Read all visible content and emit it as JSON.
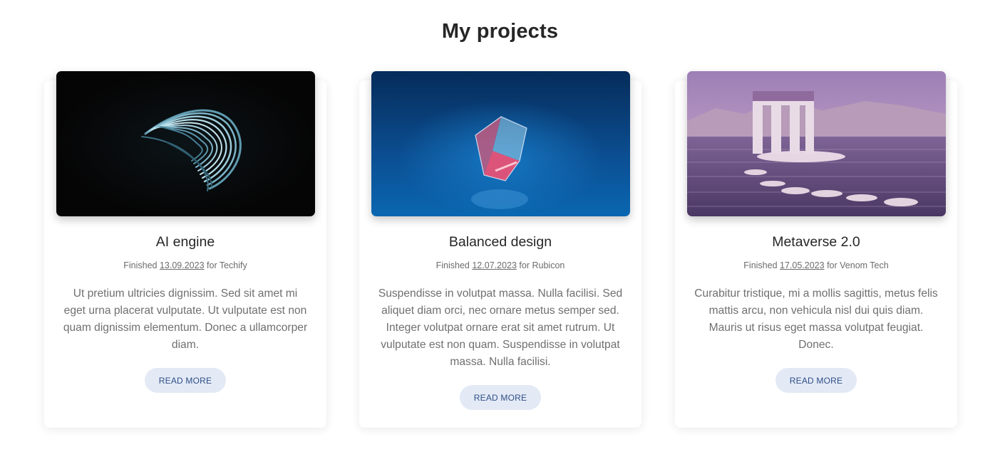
{
  "page": {
    "title": "My projects"
  },
  "projects": [
    {
      "title": "AI engine",
      "finished_prefix": "Finished",
      "date": "13.09.2023",
      "client_prefix": "for",
      "client": "Techify",
      "description": "Ut pretium ultricies dignissim. Sed sit amet mi eget urna placerat vulputate. Ut vulputate est non quam dignissim elementum. Donec a ullamcorper diam.",
      "button_label": "READ MORE",
      "image": "abstract-spiral-image"
    },
    {
      "title": "Balanced design",
      "finished_prefix": "Finished",
      "date": "12.07.2023",
      "client_prefix": "for",
      "client": "Rubicon",
      "description": "Suspendisse in volutpat massa. Nulla facilisi. Sed aliquet diam orci, nec ornare metus semper sed. Integer volutpat ornare erat sit amet rutrum. Ut vulputate est non quam. Suspendisse in volutpat massa. Nulla facilisi.",
      "button_label": "READ MORE",
      "image": "glass-cube-image"
    },
    {
      "title": "Metaverse 2.0",
      "finished_prefix": "Finished",
      "date": "17.05.2023",
      "client_prefix": "for",
      "client": "Venom Tech",
      "description": "Curabitur tristique, mi a mollis sagittis, metus felis mattis arcu, non vehicula nisl dui quis diam. Mauris ut risus eget massa volutpat feugiat. Donec.",
      "button_label": "READ MORE",
      "image": "lake-arch-image"
    }
  ],
  "colors": {
    "button_bg": "#e3eaf6",
    "button_text": "#2f4e86",
    "title_text": "#262626",
    "body_text": "#6f6f6f"
  }
}
